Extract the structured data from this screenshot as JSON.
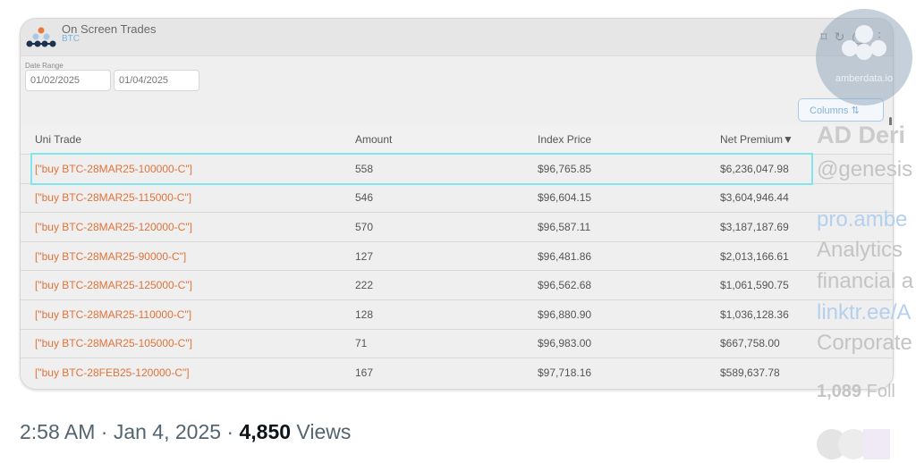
{
  "widget": {
    "title": "On Screen Trades",
    "subtitle": "BTC",
    "date_range_label": "Date Range",
    "date_from": "01/02/2025",
    "date_to": "01/04/2025",
    "columns_button": "Columns",
    "columns": [
      "Uni Trade",
      "Amount",
      "Index Price",
      "Net Premium"
    ],
    "sort_indicator": "▼",
    "rows": [
      [
        "[\"buy BTC-28MAR25-100000-C\"]",
        "558",
        "$96,765.85",
        "$6,236,047.98"
      ],
      [
        "[\"buy BTC-28MAR25-115000-C\"]",
        "546",
        "$96,604.15",
        "$3,604,946.44"
      ],
      [
        "[\"buy BTC-28MAR25-120000-C\"]",
        "570",
        "$96,587.11",
        "$3,187,187.69"
      ],
      [
        "[\"buy BTC-28MAR25-90000-C\"]",
        "127",
        "$96,481.86",
        "$2,013,166.61"
      ],
      [
        "[\"buy BTC-28MAR25-125000-C\"]",
        "222",
        "$96,562.68",
        "$1,061,590.75"
      ],
      [
        "[\"buy BTC-28MAR25-110000-C\"]",
        "128",
        "$96,880.90",
        "$1,036,128.36"
      ],
      [
        "[\"buy BTC-28MAR25-105000-C\"]",
        "71",
        "$96,983.00",
        "$667,758.00"
      ],
      [
        "[\"buy BTC-28FEB25-120000-C\"]",
        "167",
        "$97,718.16",
        "$589,637.78"
      ]
    ],
    "accent_color": "#e0733a",
    "highlight_color": "#7fe6ee"
  },
  "watermark": "amberdata.io",
  "profile_panel": {
    "name": "AD Deri",
    "handle": "@genesis",
    "link1": "pro.ambe",
    "bio1": "Analytics",
    "bio2": "financial a",
    "link2": "linktr.ee/A",
    "bio3": "Corporate",
    "followers_count": "1,089",
    "followers_label": "Foll"
  },
  "tweet_meta": {
    "time": "2:58 AM · Jan 4, 2025 · ",
    "views_count": "4,850",
    "views_label": " Views"
  }
}
